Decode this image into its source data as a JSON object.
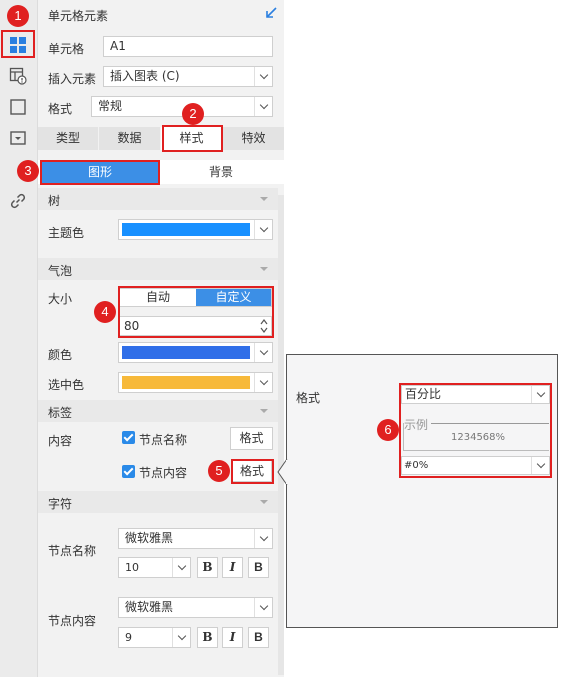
{
  "panel": {
    "title": "单元格元素",
    "cell_label": "单元格",
    "cell_value": "A1",
    "insert_label": "插入元素",
    "insert_value": "插入图表 (C)",
    "format_label": "格式",
    "format_value": "常规"
  },
  "tabs": [
    "类型",
    "数据",
    "样式",
    "特效"
  ],
  "subtabs": [
    "图形",
    "背景"
  ],
  "sections": {
    "tree": {
      "title": "树",
      "theme_color_label": "主题色"
    },
    "bubble": {
      "title": "气泡",
      "size_label": "大小",
      "size_options": [
        "自动",
        "自定义"
      ],
      "size_value": "80",
      "color_label": "颜色",
      "selected_color_label": "选中色"
    },
    "label": {
      "title": "标签",
      "content_label": "内容",
      "node_name": "节点名称",
      "node_content": "节点内容",
      "format_btn": "格式",
      "format_btn2": "格式"
    },
    "char": {
      "title": "字符",
      "node_name_label": "节点名称",
      "node_name_font": "微软雅黑",
      "node_name_size": "10",
      "node_content_label": "节点内容",
      "node_content_font": "微软雅黑",
      "node_content_size": "9",
      "bold": "B",
      "italic": "I",
      "bold_b": "B"
    }
  },
  "popup": {
    "format_label": "格式",
    "format_value": "百分比",
    "example_label": "示例",
    "example_value": "1234568%",
    "pattern_value": "#0%"
  },
  "badges": [
    "1",
    "2",
    "3",
    "4",
    "5",
    "6"
  ],
  "colors": {
    "theme": "#1890ff",
    "bubble": "#2f6ee8",
    "selected": "#f7b93a",
    "accent": "#3c8fe6",
    "annotation": "#e02020"
  }
}
